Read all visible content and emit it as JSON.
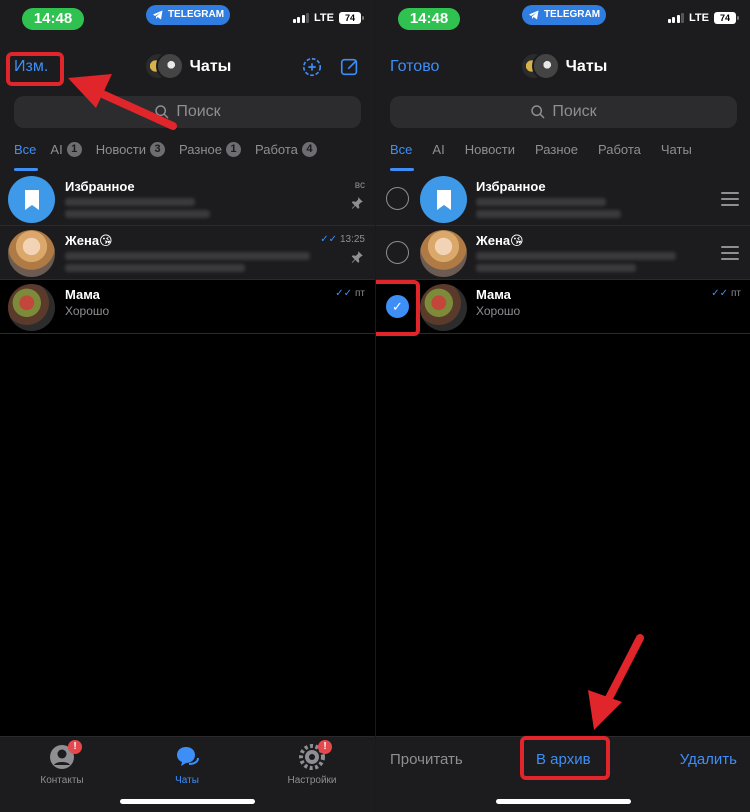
{
  "status": {
    "time": "14:48",
    "app_pill": "TELEGRAM",
    "network": "LTE",
    "battery": "74"
  },
  "left": {
    "nav_left": "Изм.",
    "title": "Чаты",
    "search_placeholder": "Поиск",
    "tabs": [
      {
        "label": "Все",
        "badge": ""
      },
      {
        "label": "AI",
        "badge": "1"
      },
      {
        "label": "Новости",
        "badge": "3"
      },
      {
        "label": "Разное",
        "badge": "1"
      },
      {
        "label": "Работа",
        "badge": "4"
      }
    ],
    "chats": [
      {
        "name": "Избранное",
        "time": "вс",
        "preview": ""
      },
      {
        "name": "Жена😘",
        "time": "13:25",
        "preview": ""
      },
      {
        "name": "Мама",
        "time": "пт",
        "preview": "Хорошо"
      }
    ],
    "tabbar": [
      {
        "label": "Контакты",
        "badge": "!"
      },
      {
        "label": "Чаты",
        "badge": ""
      },
      {
        "label": "Настройки",
        "badge": "!"
      }
    ]
  },
  "right": {
    "nav_left": "Готово",
    "title": "Чаты",
    "search_placeholder": "Поиск",
    "tabs": [
      {
        "label": "Все"
      },
      {
        "label": "AI"
      },
      {
        "label": "Новости"
      },
      {
        "label": "Разное"
      },
      {
        "label": "Работа"
      },
      {
        "label": "Чаты"
      }
    ],
    "chats": [
      {
        "name": "Избранное",
        "time": "",
        "preview": ""
      },
      {
        "name": "Жена😘",
        "time": "",
        "preview": ""
      },
      {
        "name": "Мама",
        "time": "пт",
        "preview": "Хорошо"
      }
    ],
    "actions": {
      "read": "Прочитать",
      "archive": "В архив",
      "delete": "Удалить"
    }
  },
  "colors": {
    "accent": "#3e8ef7",
    "annotation": "#e0252b",
    "status_green": "#30c250"
  }
}
